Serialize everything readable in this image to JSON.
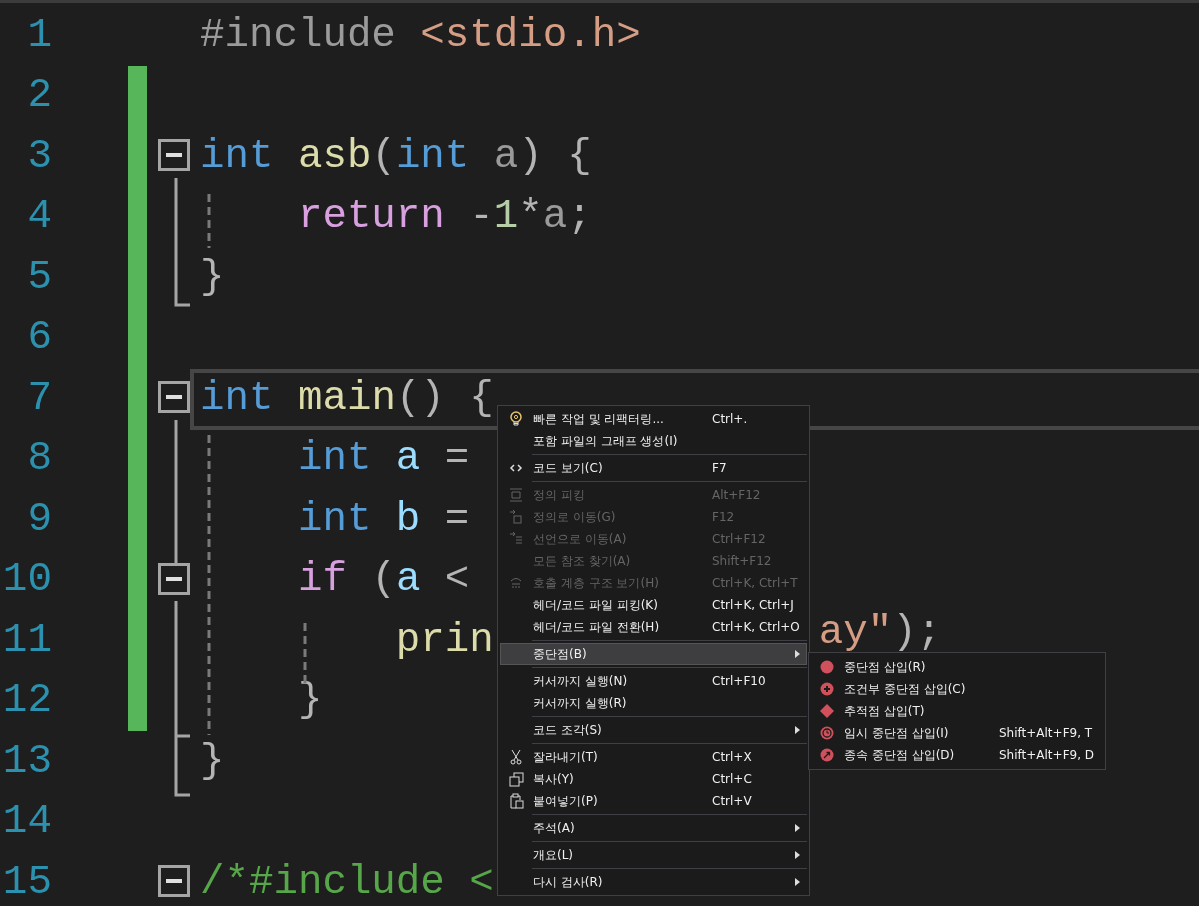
{
  "editor": {
    "lines": [
      {
        "number": "1",
        "changed": false,
        "current": false,
        "tokens": [
          {
            "text": "#include ",
            "kind": "preproc"
          },
          {
            "text": "<stdio.h>",
            "kind": "string"
          }
        ]
      },
      {
        "number": "2",
        "changed": true,
        "current": false
      },
      {
        "number": "3",
        "changed": true,
        "current": false,
        "collapsed": false,
        "tokens": [
          {
            "text": "int ",
            "kind": "keyword"
          },
          {
            "text": "asb",
            "kind": "function"
          },
          {
            "text": "(",
            "kind": "punct"
          },
          {
            "text": "int ",
            "kind": "keyword"
          },
          {
            "text": "a",
            "kind": "param"
          },
          {
            "text": ") {",
            "kind": "punct"
          }
        ]
      },
      {
        "number": "4",
        "changed": true,
        "current": false,
        "tokens": [
          {
            "text": "    return",
            "kind": "control"
          },
          {
            "text": " -",
            "kind": "punct"
          },
          {
            "text": "1",
            "kind": "number"
          },
          {
            "text": "*",
            "kind": "punct"
          },
          {
            "text": "a",
            "kind": "param"
          },
          {
            "text": ";",
            "kind": "punct"
          }
        ]
      },
      {
        "number": "5",
        "changed": true,
        "current": false,
        "tokens": [
          {
            "text": "}",
            "kind": "punct"
          }
        ]
      },
      {
        "number": "6",
        "changed": true,
        "current": false
      },
      {
        "number": "7",
        "changed": true,
        "current": true,
        "collapsed": false,
        "tokens": [
          {
            "text": "int ",
            "kind": "keyword"
          },
          {
            "text": "main",
            "kind": "function"
          },
          {
            "text": "() {",
            "kind": "punct"
          }
        ]
      },
      {
        "number": "8",
        "changed": true,
        "current": false,
        "tokens": [
          {
            "text": "    int ",
            "kind": "keyword"
          },
          {
            "text": "a",
            "kind": "local"
          },
          {
            "text": " =",
            "kind": "punct"
          }
        ]
      },
      {
        "number": "9",
        "changed": true,
        "current": false,
        "tokens": [
          {
            "text": "    int ",
            "kind": "keyword"
          },
          {
            "text": "b",
            "kind": "local"
          },
          {
            "text": " =",
            "kind": "punct"
          }
        ]
      },
      {
        "number": "10",
        "changed": true,
        "current": false,
        "collapsed": false,
        "tokens": [
          {
            "text": "    if",
            "kind": "control"
          },
          {
            "text": " (",
            "kind": "punct"
          },
          {
            "text": "a",
            "kind": "local"
          },
          {
            "text": " <",
            "kind": "punct"
          }
        ]
      },
      {
        "number": "11",
        "changed": true,
        "current": false,
        "tokens": [
          {
            "text": "        prin",
            "kind": "function"
          },
          {
            "text": "ay\"",
            "kind": "string",
            "gap": true
          },
          {
            "text": ");",
            "kind": "punct"
          }
        ]
      },
      {
        "number": "12",
        "changed": true,
        "current": false,
        "tokens": [
          {
            "text": "    }",
            "kind": "punct"
          }
        ]
      },
      {
        "number": "13",
        "changed": false,
        "current": false,
        "tokens": [
          {
            "text": "}",
            "kind": "punct"
          }
        ]
      },
      {
        "number": "14",
        "changed": false,
        "current": false
      },
      {
        "number": "15",
        "changed": false,
        "current": false,
        "collapsed": false,
        "tokens": [
          {
            "text": "/*#include <",
            "kind": "comment"
          }
        ]
      }
    ]
  },
  "context_menu": {
    "items": [
      {
        "kind": "item",
        "label": "빠른 작업 및 리팩터링...",
        "shortcut": "Ctrl+.",
        "disabled": false
      },
      {
        "kind": "item",
        "label": "포함 파일의 그래프 생성(I)",
        "disabled": false
      },
      {
        "kind": "separator"
      },
      {
        "kind": "item",
        "label": "코드 보기(C)",
        "shortcut": "F7",
        "disabled": false
      },
      {
        "kind": "separator"
      },
      {
        "kind": "item",
        "label": "정의 피킹",
        "shortcut": "Alt+F12",
        "disabled": true
      },
      {
        "kind": "item",
        "label": "정의로 이동(G)",
        "shortcut": "F12",
        "disabled": true
      },
      {
        "kind": "item",
        "label": "선언으로 이동(A)",
        "shortcut": "Ctrl+F12",
        "disabled": true
      },
      {
        "kind": "item",
        "label": "모든 참조 찾기(A)",
        "shortcut": "Shift+F12",
        "disabled": true
      },
      {
        "kind": "item",
        "label": "호출 계층 구조 보기(H)",
        "shortcut": "Ctrl+K, Ctrl+T",
        "disabled": true
      },
      {
        "kind": "item",
        "label": "헤더/코드 파일 피킹(K)",
        "shortcut": "Ctrl+K, Ctrl+J",
        "disabled": false
      },
      {
        "kind": "item",
        "label": "헤더/코드 파일 전환(H)",
        "shortcut": "Ctrl+K, Ctrl+O",
        "disabled": false
      },
      {
        "kind": "separator"
      },
      {
        "kind": "item",
        "label": "중단점(B)",
        "submenu": true,
        "selected": true,
        "disabled": false
      },
      {
        "kind": "separator"
      },
      {
        "kind": "item",
        "label": "커서까지 실행(N)",
        "shortcut": "Ctrl+F10",
        "disabled": false
      },
      {
        "kind": "item",
        "label": "커서까지 실행(R)",
        "disabled": false
      },
      {
        "kind": "separator"
      },
      {
        "kind": "item",
        "label": "코드 조각(S)",
        "submenu": true,
        "disabled": false
      },
      {
        "kind": "separator"
      },
      {
        "kind": "item",
        "label": "잘라내기(T)",
        "shortcut": "Ctrl+X",
        "disabled": false
      },
      {
        "kind": "item",
        "label": "복사(Y)",
        "shortcut": "Ctrl+C",
        "disabled": false
      },
      {
        "kind": "item",
        "label": "붙여넣기(P)",
        "shortcut": "Ctrl+V",
        "disabled": false
      },
      {
        "kind": "separator"
      },
      {
        "kind": "item",
        "label": "주석(A)",
        "submenu": true,
        "disabled": false
      },
      {
        "kind": "separator"
      },
      {
        "kind": "item",
        "label": "개요(L)",
        "submenu": true,
        "disabled": false
      },
      {
        "kind": "separator"
      },
      {
        "kind": "item",
        "label": "다시 검사(R)",
        "submenu": true,
        "disabled": false
      }
    ]
  },
  "breakpoint_submenu": {
    "items": [
      {
        "label": "중단점 삽입(R)"
      },
      {
        "label": "조건부 중단점 삽입(C)"
      },
      {
        "label": "추적점 삽입(T)"
      },
      {
        "label": "임시 중단점 삽입(I)",
        "shortcut": "Shift+Alt+F9, T"
      },
      {
        "label": "종속 중단점 삽입(D)",
        "shortcut": "Shift+Alt+F9, D"
      }
    ]
  }
}
